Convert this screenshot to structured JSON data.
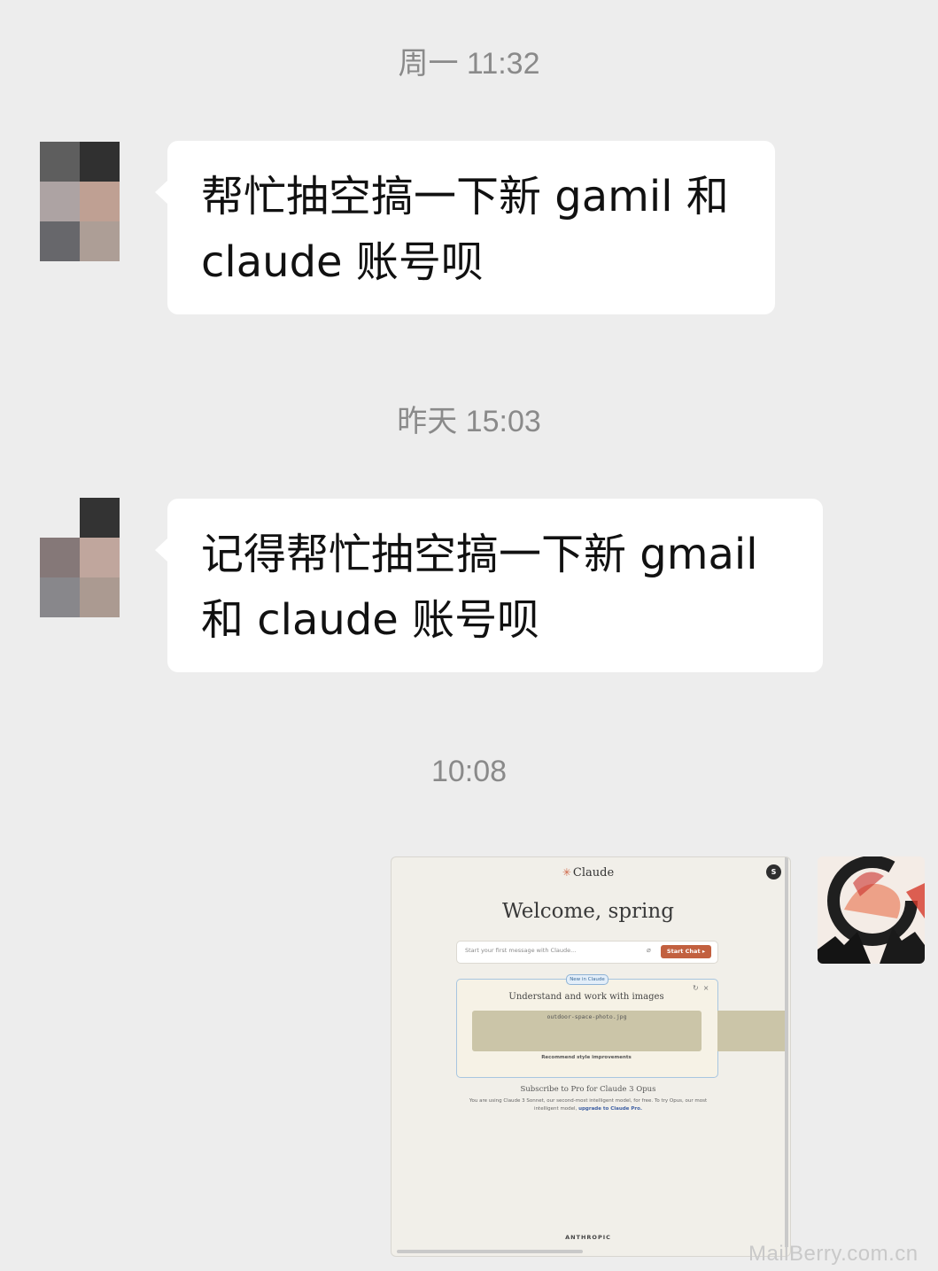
{
  "chat": {
    "timestamps": [
      "周一 11:32",
      "昨天 15:03",
      "10:08"
    ],
    "messages": [
      {
        "sender": "contact",
        "lines": [
          "帮忙抽空搞一下新 gamil 和",
          "claude 账号呗"
        ]
      },
      {
        "sender": "contact",
        "lines": [
          "记得帮忙抽空搞一下新 gmail",
          "和 claude 账号呗"
        ]
      }
    ]
  },
  "shared_image": {
    "brand": "Claude",
    "account_initial": "S",
    "welcome": "Welcome, spring",
    "input_placeholder": "Start your first message with Claude...",
    "start_chat": "Start Chat",
    "new_badge": "New in Claude",
    "card_title": "Understand and work with images",
    "image_filename": "outdoor-space-photo.jpg",
    "card_action": "Recommend style improvements",
    "subscribe_title": "Subscribe to Pro for Claude 3 Opus",
    "subscribe_text": "You are using Claude 3 Sonnet, our second-most intelligent model, for free. To try Opus, our most intelligent model,",
    "subscribe_link": "upgrade to Claude Pro.",
    "footer": "ANTHROPIC"
  },
  "watermark": "MailBerry.com.cn",
  "colors": {
    "background": "#ededed",
    "bubble": "#ffffff",
    "claude_accent": "#c2603f"
  }
}
